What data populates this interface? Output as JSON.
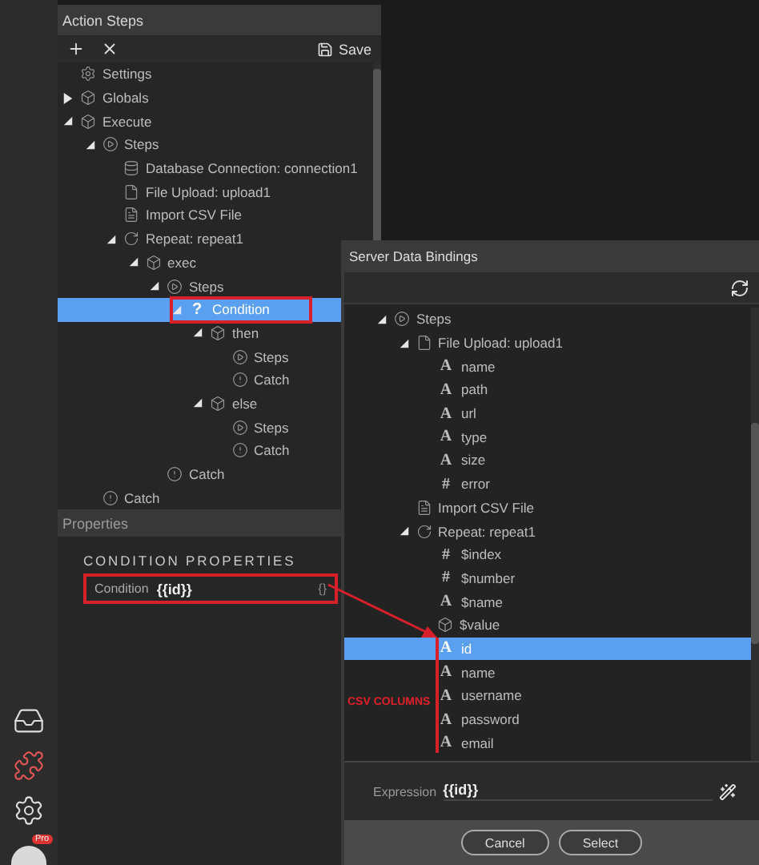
{
  "action_steps": {
    "title": "Action Steps",
    "save_label": "Save",
    "tree": [
      {
        "label": "Settings",
        "kind": "settings"
      },
      {
        "label": "Globals",
        "kind": "group",
        "expanded": false
      },
      {
        "label": "Execute",
        "kind": "group",
        "expanded": true,
        "children": [
          {
            "label": "Steps",
            "kind": "steps",
            "expanded": true,
            "children": [
              {
                "label": "Database Connection: connection1",
                "kind": "database"
              },
              {
                "label": "File Upload: upload1",
                "kind": "file"
              },
              {
                "label": "Import CSV File",
                "kind": "document"
              },
              {
                "label": "Repeat: repeat1",
                "kind": "repeat",
                "expanded": true,
                "children": [
                  {
                    "label": "exec",
                    "kind": "group",
                    "expanded": true,
                    "children": [
                      {
                        "label": "Steps",
                        "kind": "steps",
                        "expanded": true,
                        "children": [
                          {
                            "label": "Condition",
                            "glyph": "?",
                            "expanded": true,
                            "selected": true,
                            "annotated": true,
                            "children": [
                              {
                                "label": "then",
                                "kind": "group",
                                "expanded": true,
                                "children": [
                                  {
                                    "label": "Steps",
                                    "kind": "steps"
                                  },
                                  {
                                    "label": "Catch",
                                    "kind": "catch"
                                  }
                                ]
                              },
                              {
                                "label": "else",
                                "kind": "group",
                                "expanded": true,
                                "children": [
                                  {
                                    "label": "Steps",
                                    "kind": "steps"
                                  },
                                  {
                                    "label": "Catch",
                                    "kind": "catch"
                                  }
                                ]
                              }
                            ]
                          }
                        ]
                      },
                      {
                        "label": "Catch",
                        "kind": "catch"
                      }
                    ]
                  }
                ]
              }
            ]
          },
          {
            "label": "Catch",
            "kind": "catch"
          }
        ]
      }
    ]
  },
  "properties": {
    "title": "Properties",
    "section": "CONDITION PROPERTIES",
    "field_label": "Condition",
    "field_value": "{{id}}",
    "bind_glyph": "{}",
    "annotated": true
  },
  "dialog": {
    "title": "Server Data Bindings",
    "tree": [
      {
        "label": "Steps",
        "kind": "steps",
        "expanded": true,
        "children": [
          {
            "label": "File Upload: upload1",
            "kind": "file",
            "expanded": true,
            "children": [
              {
                "label": "name",
                "glyph": "A"
              },
              {
                "label": "path",
                "glyph": "A"
              },
              {
                "label": "url",
                "glyph": "A"
              },
              {
                "label": "type",
                "glyph": "A"
              },
              {
                "label": "size",
                "glyph": "A"
              },
              {
                "label": "error",
                "glyph": "#"
              }
            ]
          },
          {
            "label": "Import CSV File",
            "kind": "document"
          },
          {
            "label": "Repeat: repeat1",
            "kind": "repeat",
            "expanded": true,
            "children": [
              {
                "label": "$index",
                "glyph": "#"
              },
              {
                "label": "$number",
                "glyph": "#"
              },
              {
                "label": "$name",
                "glyph": "A"
              },
              {
                "label": "$value",
                "kind": "group"
              },
              {
                "label": "id",
                "glyph": "A",
                "selected": true
              },
              {
                "label": "name",
                "glyph": "A",
                "selected": false
              },
              {
                "label": "username",
                "glyph": "A",
                "selected": false
              },
              {
                "label": "password",
                "glyph": "A",
                "selected": false
              },
              {
                "label": "email",
                "glyph": "A",
                "selected": false
              }
            ]
          }
        ]
      }
    ],
    "expression_label": "Expression",
    "expression_value": "{{id}}",
    "buttons": [
      "Cancel",
      "Select"
    ]
  },
  "annotation": {
    "label": "CSV COLUMNS"
  },
  "sidebar": {
    "badge": "Pro"
  }
}
